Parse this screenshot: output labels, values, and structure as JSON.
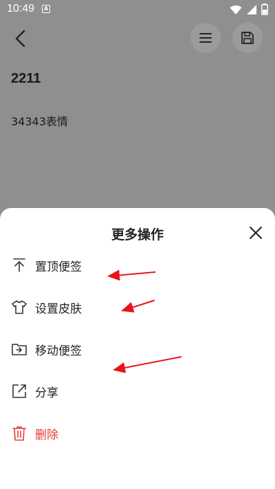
{
  "status_bar": {
    "time": "10:49",
    "notification_label": "A"
  },
  "note": {
    "title": "2211",
    "body": "34343表情"
  },
  "sheet": {
    "title": "更多操作",
    "items": [
      {
        "label": "置顶便签",
        "icon": "pin-top-icon"
      },
      {
        "label": "设置皮肤",
        "icon": "tshirt-icon"
      },
      {
        "label": "移动便签",
        "icon": "move-folder-icon"
      },
      {
        "label": "分享",
        "icon": "share-icon"
      },
      {
        "label": "删除",
        "icon": "trash-icon"
      }
    ]
  },
  "colors": {
    "danger": "#e53935",
    "overlay": "#8f8f8f",
    "annotation_arrow": "#e8141b"
  }
}
